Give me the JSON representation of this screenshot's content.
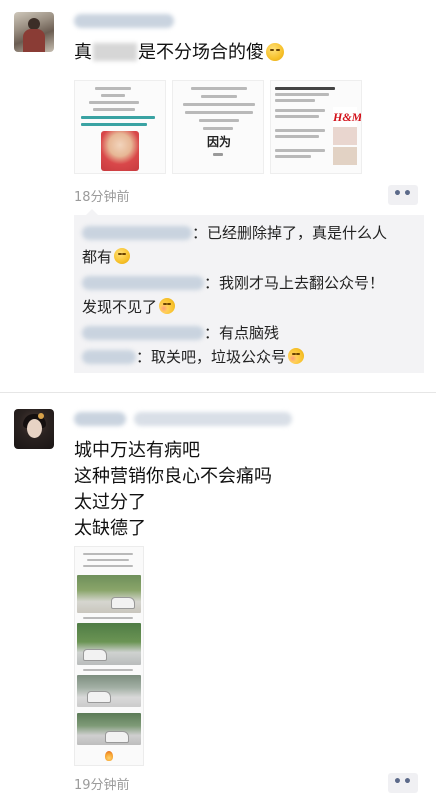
{
  "post1": {
    "text_prefix": "真",
    "text_suffix": "是不分场合的傻",
    "emoji": "smirk-emoji",
    "image2_caption": "因为",
    "time": "18分钟前",
    "more_button": "••",
    "comments": [
      {
        "text": "：已经删除掉了，真是什么人",
        "text_line2": "都有"
      },
      {
        "text": "：我刚才马上去翻公众号！",
        "text_line2": "发现不见了"
      },
      {
        "text": "：有点脑残"
      },
      {
        "text": "：取关吧，垃圾公众号"
      }
    ]
  },
  "post2": {
    "lines": [
      "城中万达有病吧",
      "这种营销你良心不会痛吗",
      "太过分了",
      "太缺德了"
    ],
    "time": "19分钟前",
    "more_button": "••"
  },
  "colors": {
    "name_blue": "#576b95",
    "time_gray": "#9b9b9b",
    "comment_bg": "#f3f3f5",
    "brand_hm_red": "#d3111a"
  }
}
